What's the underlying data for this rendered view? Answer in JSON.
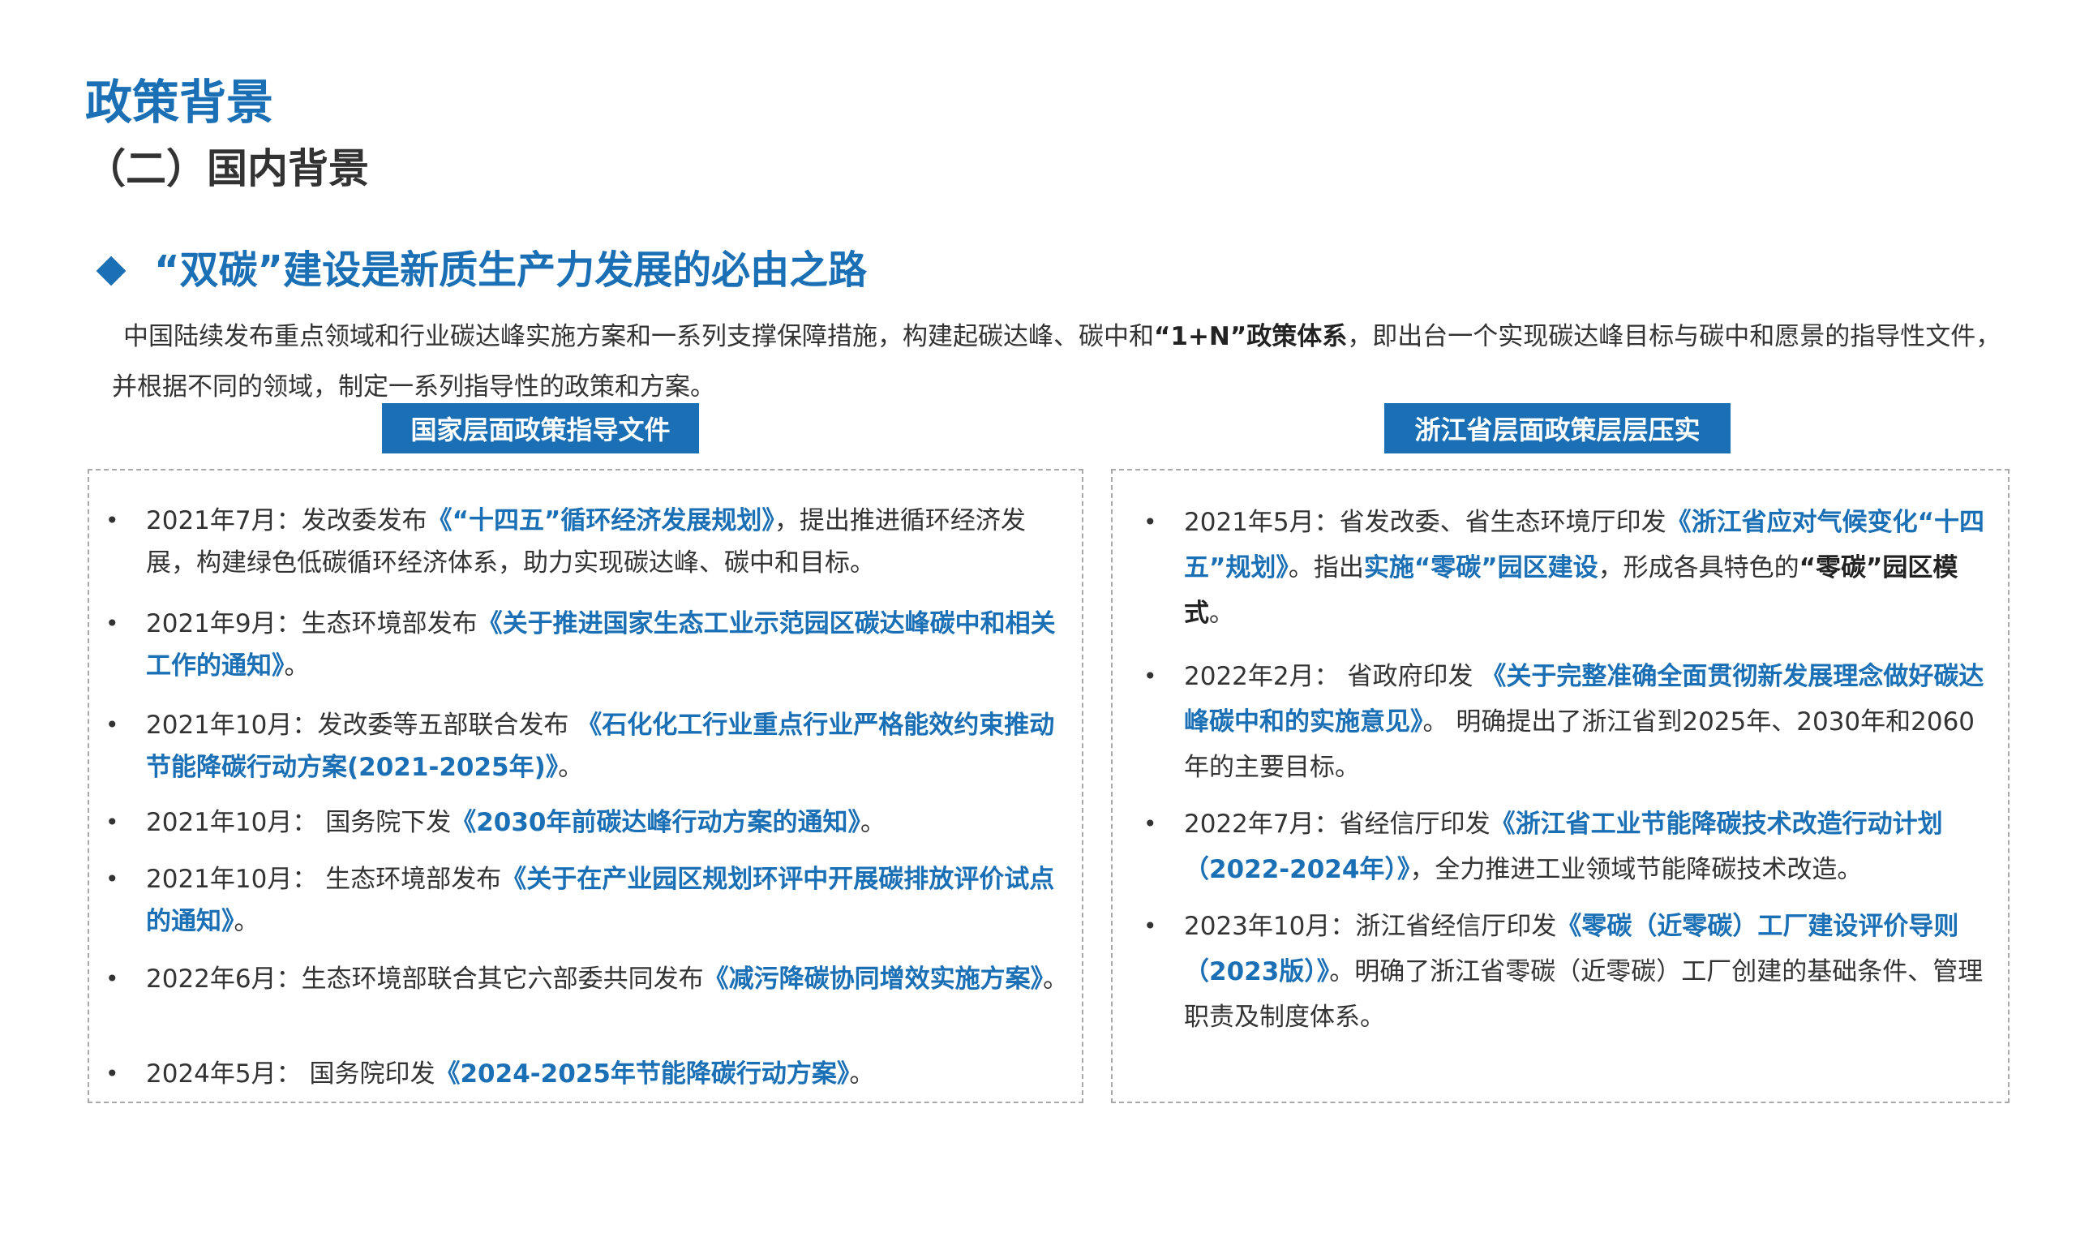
{
  "title": "政策背景",
  "subtitle": "（二）国内背景",
  "section": {
    "heading": "“双碳”建设是新质生产力发展的必由之路",
    "intro_part1": "中国陆续发布重点领域和行业碳达峰实施方案和一系列支撑保障措施，构建起碳达峰、碳中和",
    "intro_bold": "“1+N”政策体系",
    "intro_part2": "，即出台一个实现碳达峰目标与碳中和愿景的指导性文件，并根据不同的领域，制定一系列指导性的政策和方案。"
  },
  "left_panel": {
    "label": "国家层面政策指导文件",
    "items": [
      {
        "pre": "2021年7月：发改委发布",
        "hl": "《“十四五”循环经济发展规划》",
        "post": "，提出推进循环经济发展，构建绿色低碳循环经济体系，助力实现碳达峰、碳中和目标。"
      },
      {
        "pre": "2021年9月：生态环境部发布",
        "hl": "《关于推进国家生态工业示范园区碳达峰碳中和相关工作的通知》",
        "post": "。"
      },
      {
        "pre": "2021年10月：发改委等五部联合发布 ",
        "hl": "《石化化工行业重点行业严格能效约束推动节能降碳行动方案(2021-2025年)》",
        "post": "。"
      },
      {
        "pre": "2021年10月： 国务院下发",
        "hl": "《2030年前碳达峰行动方案的通知》",
        "post": "。"
      },
      {
        "pre": "2021年10月： 生态环境部发布",
        "hl": "《关于在产业园区规划环评中开展碳排放评价试点的通知》",
        "post": "。"
      },
      {
        "pre": "2022年6月：生态环境部联合其它六部委共同发布",
        "hl": "《减污降碳协同增效实施方案》",
        "post": "。"
      },
      {
        "pre": "2024年5月： 国务院印发",
        "hl": "《2024-2025年节能降碳行动方案》",
        "post": "。"
      }
    ]
  },
  "right_panel": {
    "label": "浙江省层面政策层层压实",
    "items": [
      {
        "pre": "2021年5月：省发改委、省生态环境厅印发",
        "hl": "《浙江省应对气候变化“十四五”规划》",
        "mid": "。指出",
        "hl2": "实施“零碳”园区建设",
        "mid2": "，形成各具特色的",
        "strong": "“零碳”园区模式",
        "post": "。"
      },
      {
        "pre": "2022年2月： 省政府印发 ",
        "hl": "《关于完整准确全面贯彻新发展理念做好碳达峰碳中和的实施意见》",
        "post": "。 明确提出了浙江省到2025年、2030年和2060年的主要目标。"
      },
      {
        "pre": "2022年7月：省经信厅印发",
        "hl": "《浙江省工业节能降碳技术改造行动计划（2022-2024年）》",
        "post": "，全力推进工业领域节能降碳技术改造。"
      },
      {
        "pre": "2023年10月：浙江省经信厅印发",
        "hl": "《零碳（近零碳）工厂建设评价导则（2023版）》",
        "post": "。明确了浙江省零碳（近零碳）工厂创建的基础条件、管理职责及制度体系。"
      }
    ]
  },
  "colors": {
    "accent": "#1a6fb5",
    "text": "#333333"
  }
}
